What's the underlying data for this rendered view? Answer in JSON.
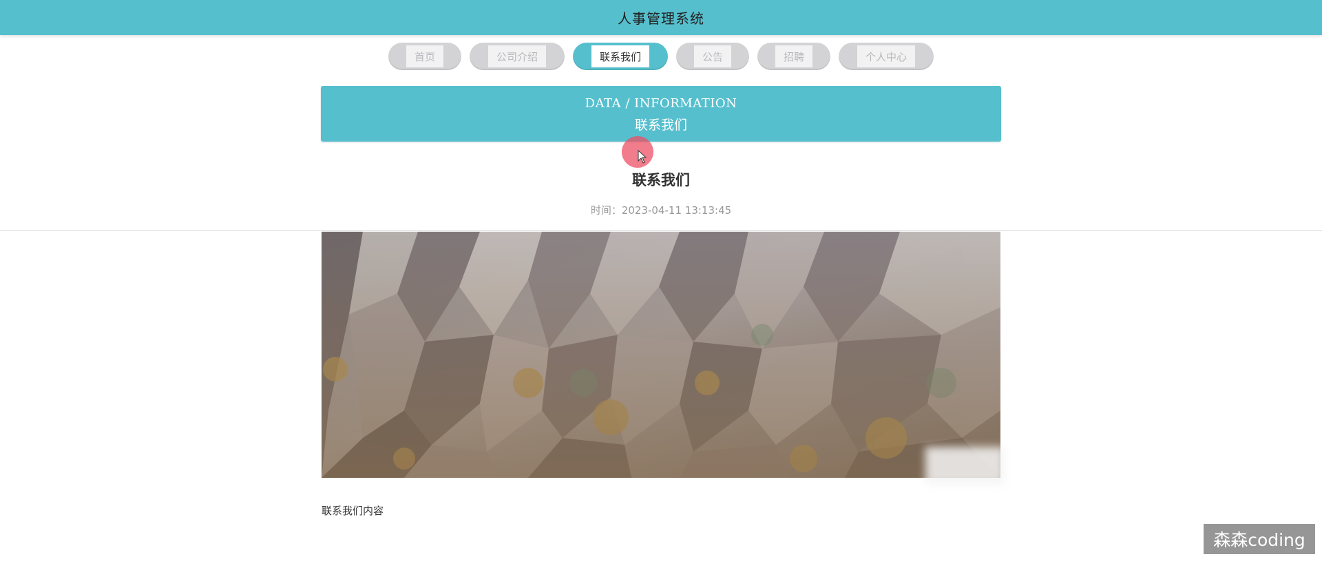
{
  "header": {
    "title": "人事管理系统"
  },
  "nav": {
    "items": [
      {
        "label": "首页"
      },
      {
        "label": "公司介绍"
      },
      {
        "label": "联系我们"
      },
      {
        "label": "公告"
      },
      {
        "label": "招聘"
      },
      {
        "label": "个人中心"
      }
    ],
    "active_index": 2
  },
  "banner": {
    "en_label": "DATA / INFORMATION",
    "cn_label": "联系我们"
  },
  "article": {
    "title": "联系我们",
    "time": "时间：2023-04-11 13:13:45",
    "content": "联系我们内容"
  },
  "watermark": {
    "text": "森森coding"
  },
  "colors": {
    "accent": "#56bfcd",
    "pill_inactive": "#d3d3d6",
    "cursor_highlight": "#ec5064"
  }
}
